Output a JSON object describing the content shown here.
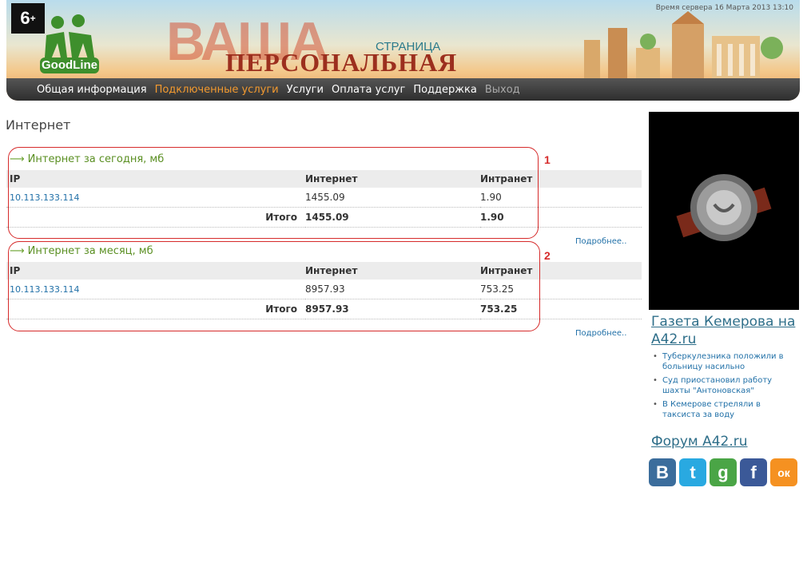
{
  "header": {
    "age_badge": "6",
    "age_badge_sup": "+",
    "logo_text": "GoodLine",
    "banner_vasha": "ВАША",
    "banner_personal": "ПЕРСОНАЛЬНАЯ",
    "banner_page": "СТРАНИЦА",
    "server_time": "Время сервера 16 Марта 2013 13:10"
  },
  "nav": {
    "items": [
      {
        "label": "Общая информация"
      },
      {
        "label": "Подключенные услуги"
      },
      {
        "label": "Услуги"
      },
      {
        "label": "Оплата услуг"
      },
      {
        "label": "Поддержка"
      },
      {
        "label": "Выход"
      }
    ],
    "active_index": 1
  },
  "main": {
    "page_title": "Интернет",
    "blocks": [
      {
        "title": "Интернет за сегодня, мб",
        "columns": [
          "IP",
          "Интернет",
          "Интранет"
        ],
        "rows": [
          {
            "ip": "10.113.133.114",
            "internet": "1455.09",
            "intranet": "1.90"
          }
        ],
        "total_label": "Итого",
        "total_internet": "1455.09",
        "total_intranet": "1.90",
        "more_label": "Подробнее..",
        "annotation": "1"
      },
      {
        "title": "Интернет за месяц, мб",
        "columns": [
          "IP",
          "Интернет",
          "Интранет"
        ],
        "rows": [
          {
            "ip": "10.113.133.114",
            "internet": "8957.93",
            "intranet": "753.25"
          }
        ],
        "total_label": "Итого",
        "total_internet": "8957.93",
        "total_intranet": "753.25",
        "more_label": "Подробнее..",
        "annotation": "2"
      }
    ]
  },
  "sidebar": {
    "newspaper_title": "Газета Кемерова на A42.ru",
    "news": [
      "Туберкулезника положили в больницу насильно",
      "Суд приостановил работу шахты \"Антоновская\"",
      "В Кемерове стреляли в таксиста за воду"
    ],
    "forum_title": "Форум A42.ru",
    "social": [
      {
        "letter": "B",
        "name": "vkontakte-icon",
        "color": "#3b6d9c"
      },
      {
        "letter": "t",
        "name": "twitter-icon",
        "color": "#29a9e1"
      },
      {
        "letter": "g",
        "name": "google-icon",
        "color": "#4aa546"
      },
      {
        "letter": "f",
        "name": "facebook-icon",
        "color": "#3b5998"
      },
      {
        "letter": "ок",
        "name": "odnoklassniki-icon",
        "color": "#f59121"
      }
    ]
  },
  "colors": {
    "accent_nav_active": "#f39a2f",
    "annotation_red": "#d62b2b",
    "link_blue": "#2271a8",
    "block_title_green": "#5a8f22"
  }
}
